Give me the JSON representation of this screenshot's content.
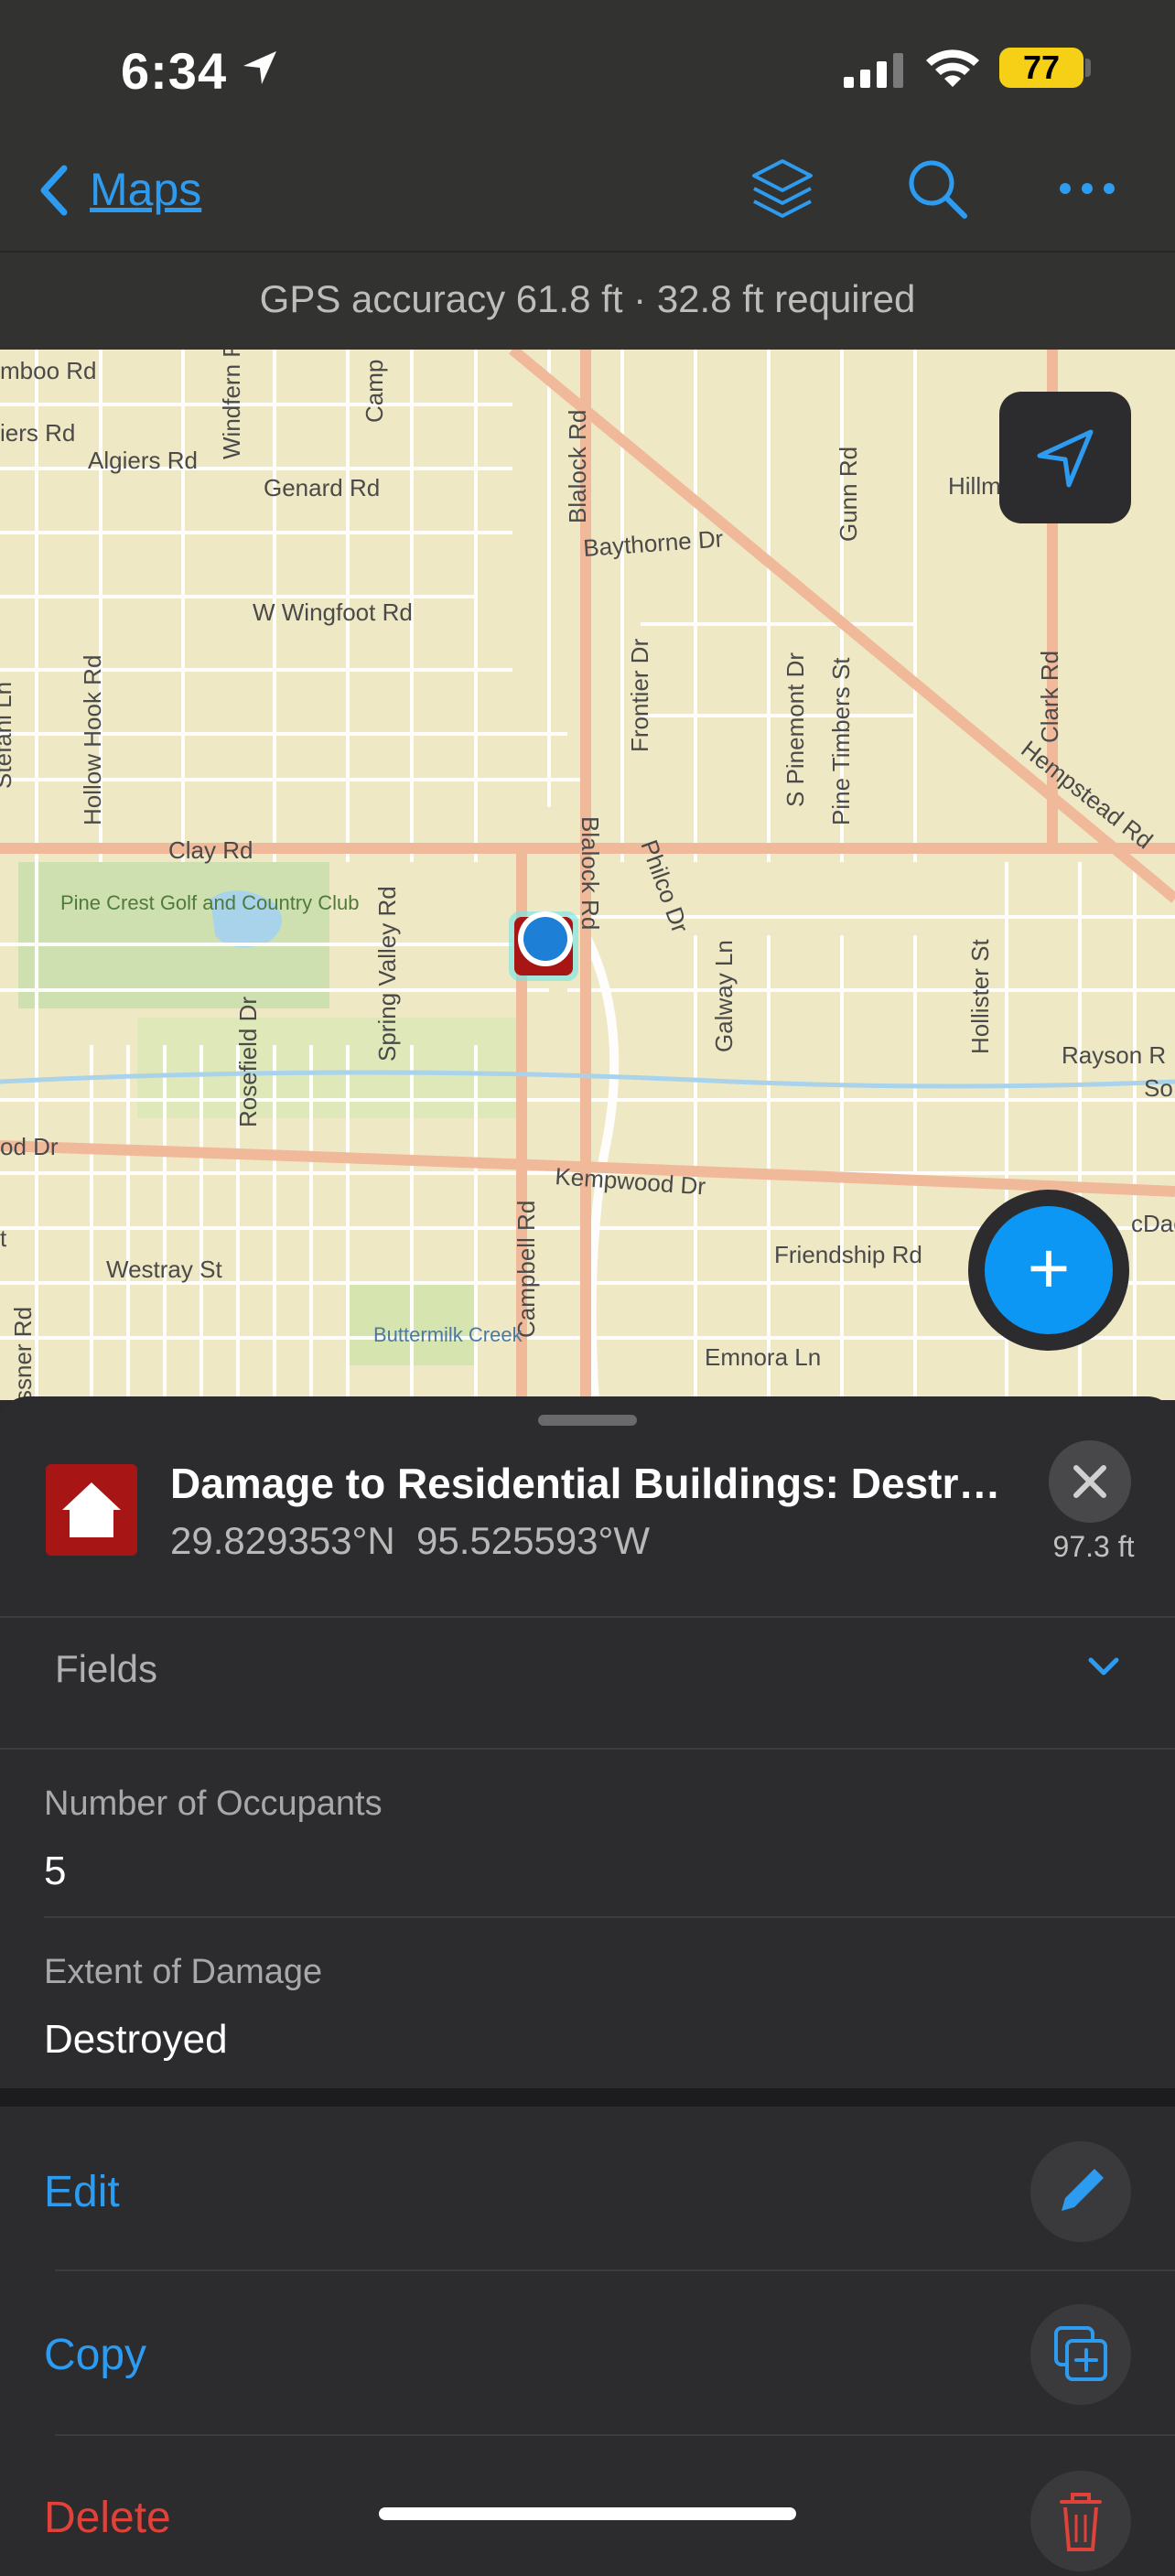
{
  "status_bar": {
    "time": "6:34",
    "battery": "77"
  },
  "nav": {
    "back_label": "Maps"
  },
  "gps_bar": {
    "text": "GPS accuracy 61.8 ft  ·  32.8 ft required"
  },
  "map": {
    "labels": {
      "tamboo": "mboo Rd",
      "miers": "iers Rd",
      "algiers": "Algiers Rd",
      "windfern": "Windfern Rd",
      "camp": "Camp",
      "genard": "Genard Rd",
      "blalock_top": "Blalock Rd",
      "gunn": "Gunn Rd",
      "hillmont": "Hillmon",
      "baythorne": "Baythorne Dr",
      "wingfoot": "W Wingfoot Rd",
      "hollowhook": "Hollow Hook Rd",
      "stefan": "Stefani Ln",
      "frontier": "Frontier Dr",
      "pinemont": "S Pinemont Dr",
      "pinetimbers": "Pine Timbers St",
      "clark": "Clark Rd",
      "hempstead": "Hempstead Rd",
      "clay": "Clay Rd",
      "pinecrest": "Pine Crest Golf and Country Club",
      "springvalley": "Spring Valley Rd",
      "blalock_mid": "Blalock Rd",
      "philco": "Philco Dr",
      "galway": "Galway Ln",
      "hollister": "Hollister St",
      "rayson": "Rayson R",
      "so": "So",
      "rosefield": "Rosefield Dr",
      "od": "od Dr",
      "kempwood": "Kempwood Dr",
      "campbell": "Campbell Rd",
      "mcdad": "cDad",
      "westray": "Westray St",
      "friendship": "Friendship Rd",
      "gessner": "ssner Rd",
      "buttermilk": "Buttermilk Creek",
      "emnora": "Emnora Ln",
      "t": "t"
    }
  },
  "feature": {
    "title": "Damage to Residential Buildings: Destroyed",
    "coords": "29.829353°N  95.525593°W",
    "distance": "97.3 ft"
  },
  "fields": {
    "header": "Fields",
    "items": [
      {
        "label": "Number of Occupants",
        "value": "5"
      },
      {
        "label": "Extent of Damage",
        "value": "Destroyed"
      }
    ]
  },
  "actions": [
    {
      "label": "Edit",
      "color": "#2d9bf0",
      "icon": "pencil-icon"
    },
    {
      "label": "Copy",
      "color": "#2d9bf0",
      "icon": "copy-add-icon"
    },
    {
      "label": "Delete",
      "color": "#e0423a",
      "icon": "trash-icon"
    }
  ],
  "colors": {
    "accent": "#2d9bf0",
    "fab": "#0b97f3",
    "danger": "#e0423a",
    "map_bg": "#efe8c4",
    "road_major": "#f0b99a",
    "road_minor": "#ffffff"
  }
}
